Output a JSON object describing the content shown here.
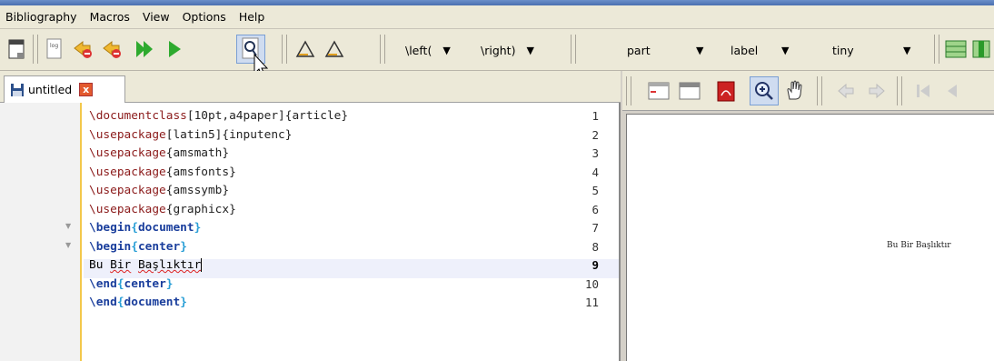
{
  "menu": [
    "Bibliography",
    "Macros",
    "View",
    "Options",
    "Help"
  ],
  "toolbar": {
    "left_delim": "\\left(",
    "right_delim": "\\right)",
    "section": "part",
    "label": "label",
    "size": "tiny"
  },
  "tab": {
    "label": "untitled",
    "close": "x"
  },
  "editor": {
    "current_line": 9,
    "lines": [
      {
        "n": "1",
        "parts": [
          [
            "cmd",
            "\\documentclass"
          ],
          [
            "arg",
            "[10pt,a4paper]{article}"
          ]
        ]
      },
      {
        "n": "2",
        "parts": [
          [
            "cmd",
            "\\usepackage"
          ],
          [
            "arg",
            "[latin5]{inputenc}"
          ]
        ]
      },
      {
        "n": "3",
        "parts": [
          [
            "cmd",
            "\\usepackage"
          ],
          [
            "arg",
            "{amsmath}"
          ]
        ]
      },
      {
        "n": "4",
        "parts": [
          [
            "cmd",
            "\\usepackage"
          ],
          [
            "arg",
            "{amsfonts}"
          ]
        ]
      },
      {
        "n": "5",
        "parts": [
          [
            "cmd",
            "\\usepackage"
          ],
          [
            "arg",
            "{amssymb}"
          ]
        ]
      },
      {
        "n": "6",
        "parts": [
          [
            "cmd",
            "\\usepackage"
          ],
          [
            "arg",
            "{graphicx}"
          ]
        ]
      },
      {
        "n": "7",
        "parts": [
          [
            "env",
            "\\begin"
          ],
          [
            "brace",
            "{"
          ],
          [
            "env",
            "document"
          ],
          [
            "brace",
            "}"
          ]
        ]
      },
      {
        "n": "8",
        "parts": [
          [
            "env",
            "\\begin"
          ],
          [
            "brace",
            "{"
          ],
          [
            "env",
            "center"
          ],
          [
            "brace",
            "}"
          ]
        ]
      },
      {
        "n": "9",
        "parts": [
          [
            "plain",
            "Bu "
          ],
          [
            "spell",
            "Bir"
          ],
          [
            "plain",
            " "
          ],
          [
            "spell",
            "Başlıktır"
          ]
        ]
      },
      {
        "n": "10",
        "parts": [
          [
            "env",
            "\\end"
          ],
          [
            "brace",
            "{"
          ],
          [
            "env",
            "center"
          ],
          [
            "brace",
            "}"
          ]
        ]
      },
      {
        "n": "11",
        "parts": [
          [
            "env",
            "\\end"
          ],
          [
            "brace",
            "{"
          ],
          [
            "env",
            "document"
          ],
          [
            "brace",
            "}"
          ]
        ]
      }
    ]
  },
  "preview": {
    "text": "Bu Bir Başlıktır"
  },
  "colors": {
    "accent": "#f3c84b",
    "current_line": "#eef0fb",
    "env": "#1a3e9c",
    "cmd": "#8b1a1a"
  }
}
